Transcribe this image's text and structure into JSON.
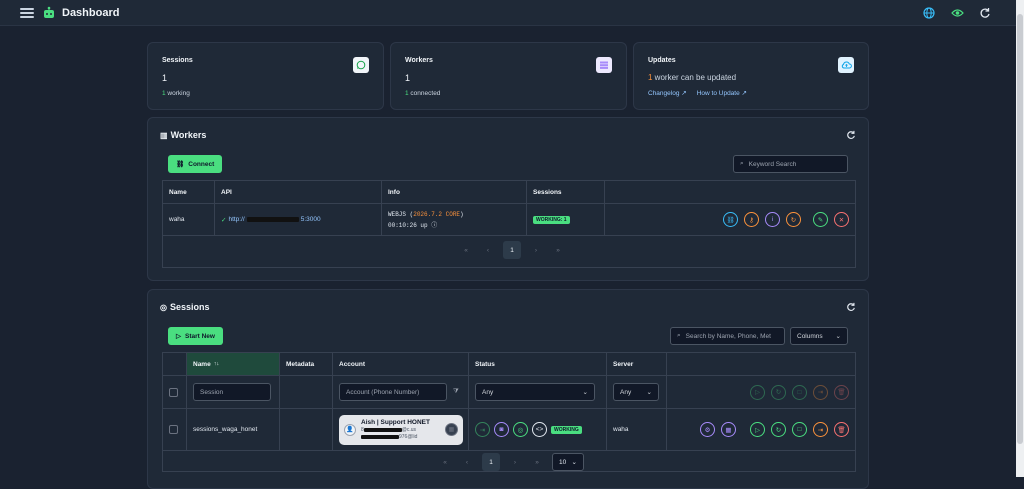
{
  "app": {
    "title": "Dashboard"
  },
  "stats": {
    "sessions": {
      "title": "Sessions",
      "value": "1",
      "sub_count": "1",
      "sub_text": " working",
      "icon": "whatsapp-icon"
    },
    "workers": {
      "title": "Workers",
      "value": "1",
      "sub_count": "1",
      "sub_text": " connected",
      "icon": "server-icon"
    },
    "updates": {
      "title": "Updates",
      "count": "1",
      "text": " worker can be updated",
      "changelog": "Changelog",
      "how_to_update": "How to Update",
      "icon": "cloud-upload-icon"
    }
  },
  "workers": {
    "title": "Workers",
    "connect_label": "Connect",
    "search_placeholder": "Keyword Search",
    "columns": [
      "Name",
      "API",
      "Info",
      "Sessions"
    ],
    "rows": [
      {
        "name": "waha",
        "api_prefix": "http://",
        "api_suffix": "5:3000",
        "engine": "WEBJS",
        "version": "2026.7.2 CORE",
        "uptime": "00:10:26 up",
        "badge": "WORKING: 1"
      }
    ],
    "pagination": {
      "first": "«",
      "prev": "‹",
      "current": "1",
      "next": "›",
      "last": "»"
    }
  },
  "sessions": {
    "title": "Sessions",
    "start_label": "Start New",
    "search_placeholder": "Search by Name, Phone, Met",
    "columns_label": "Columns",
    "columns": [
      "Name",
      "Metadata",
      "Account",
      "Status",
      "Server"
    ],
    "sort_icon": "↑↓",
    "filters": {
      "session_placeholder": "Session",
      "account_placeholder": "Account (Phone Number)",
      "status_value": "Any",
      "server_value": "Any"
    },
    "rows": [
      {
        "name": "sessions_waga_honet",
        "account_name": "Aish | Support HONET",
        "account_id_prefix": "8",
        "account_id_suffix": "@c.us",
        "account_lid_suffix": "976@lid",
        "status_badge": "WORKING",
        "server": "waha"
      }
    ],
    "pagination": {
      "first": "«",
      "prev": "‹",
      "current": "1",
      "next": "›",
      "last": "»",
      "page_size": "10"
    }
  },
  "colors": {
    "bg": "#1a2230",
    "card": "#1f2937",
    "accent_green": "#4ade80",
    "orange": "#fb923c",
    "blue": "#38bdf8",
    "purple": "#a78bfa",
    "red": "#f87171"
  }
}
